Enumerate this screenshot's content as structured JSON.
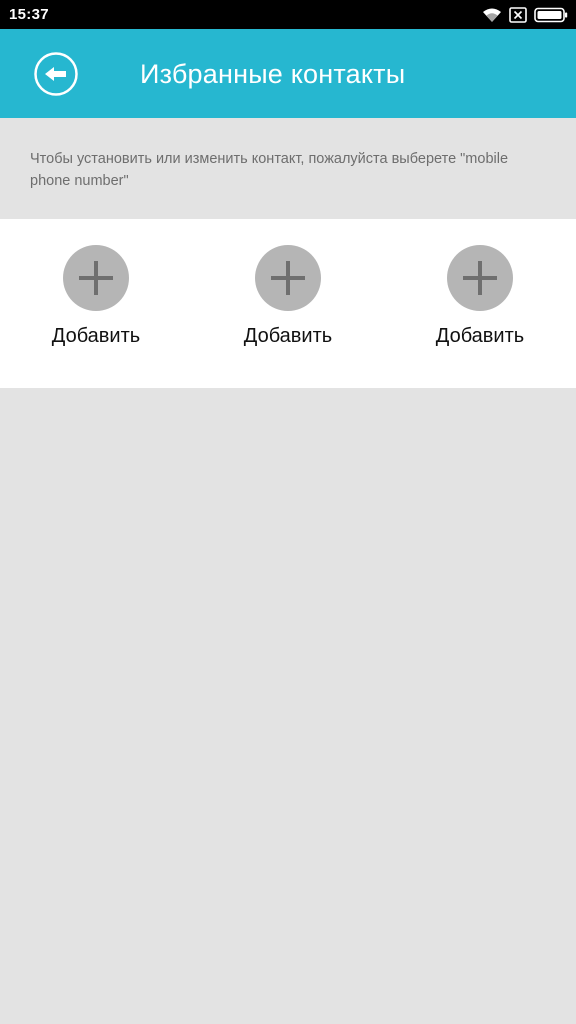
{
  "status_bar": {
    "time": "15:37",
    "icons": [
      "wifi-icon",
      "no-sim-icon",
      "battery-icon"
    ]
  },
  "app_bar": {
    "title": "Избранные контакты",
    "back_icon": "back-arrow-icon",
    "background_color": "#26b7d0"
  },
  "hint": {
    "text": "Чтобы установить или изменить контакт, пожалуйста выберете \"mobile phone number\""
  },
  "contacts": {
    "slots": [
      {
        "label": "Добавить",
        "icon": "plus-icon"
      },
      {
        "label": "Добавить",
        "icon": "plus-icon"
      },
      {
        "label": "Добавить",
        "icon": "plus-icon"
      }
    ]
  }
}
